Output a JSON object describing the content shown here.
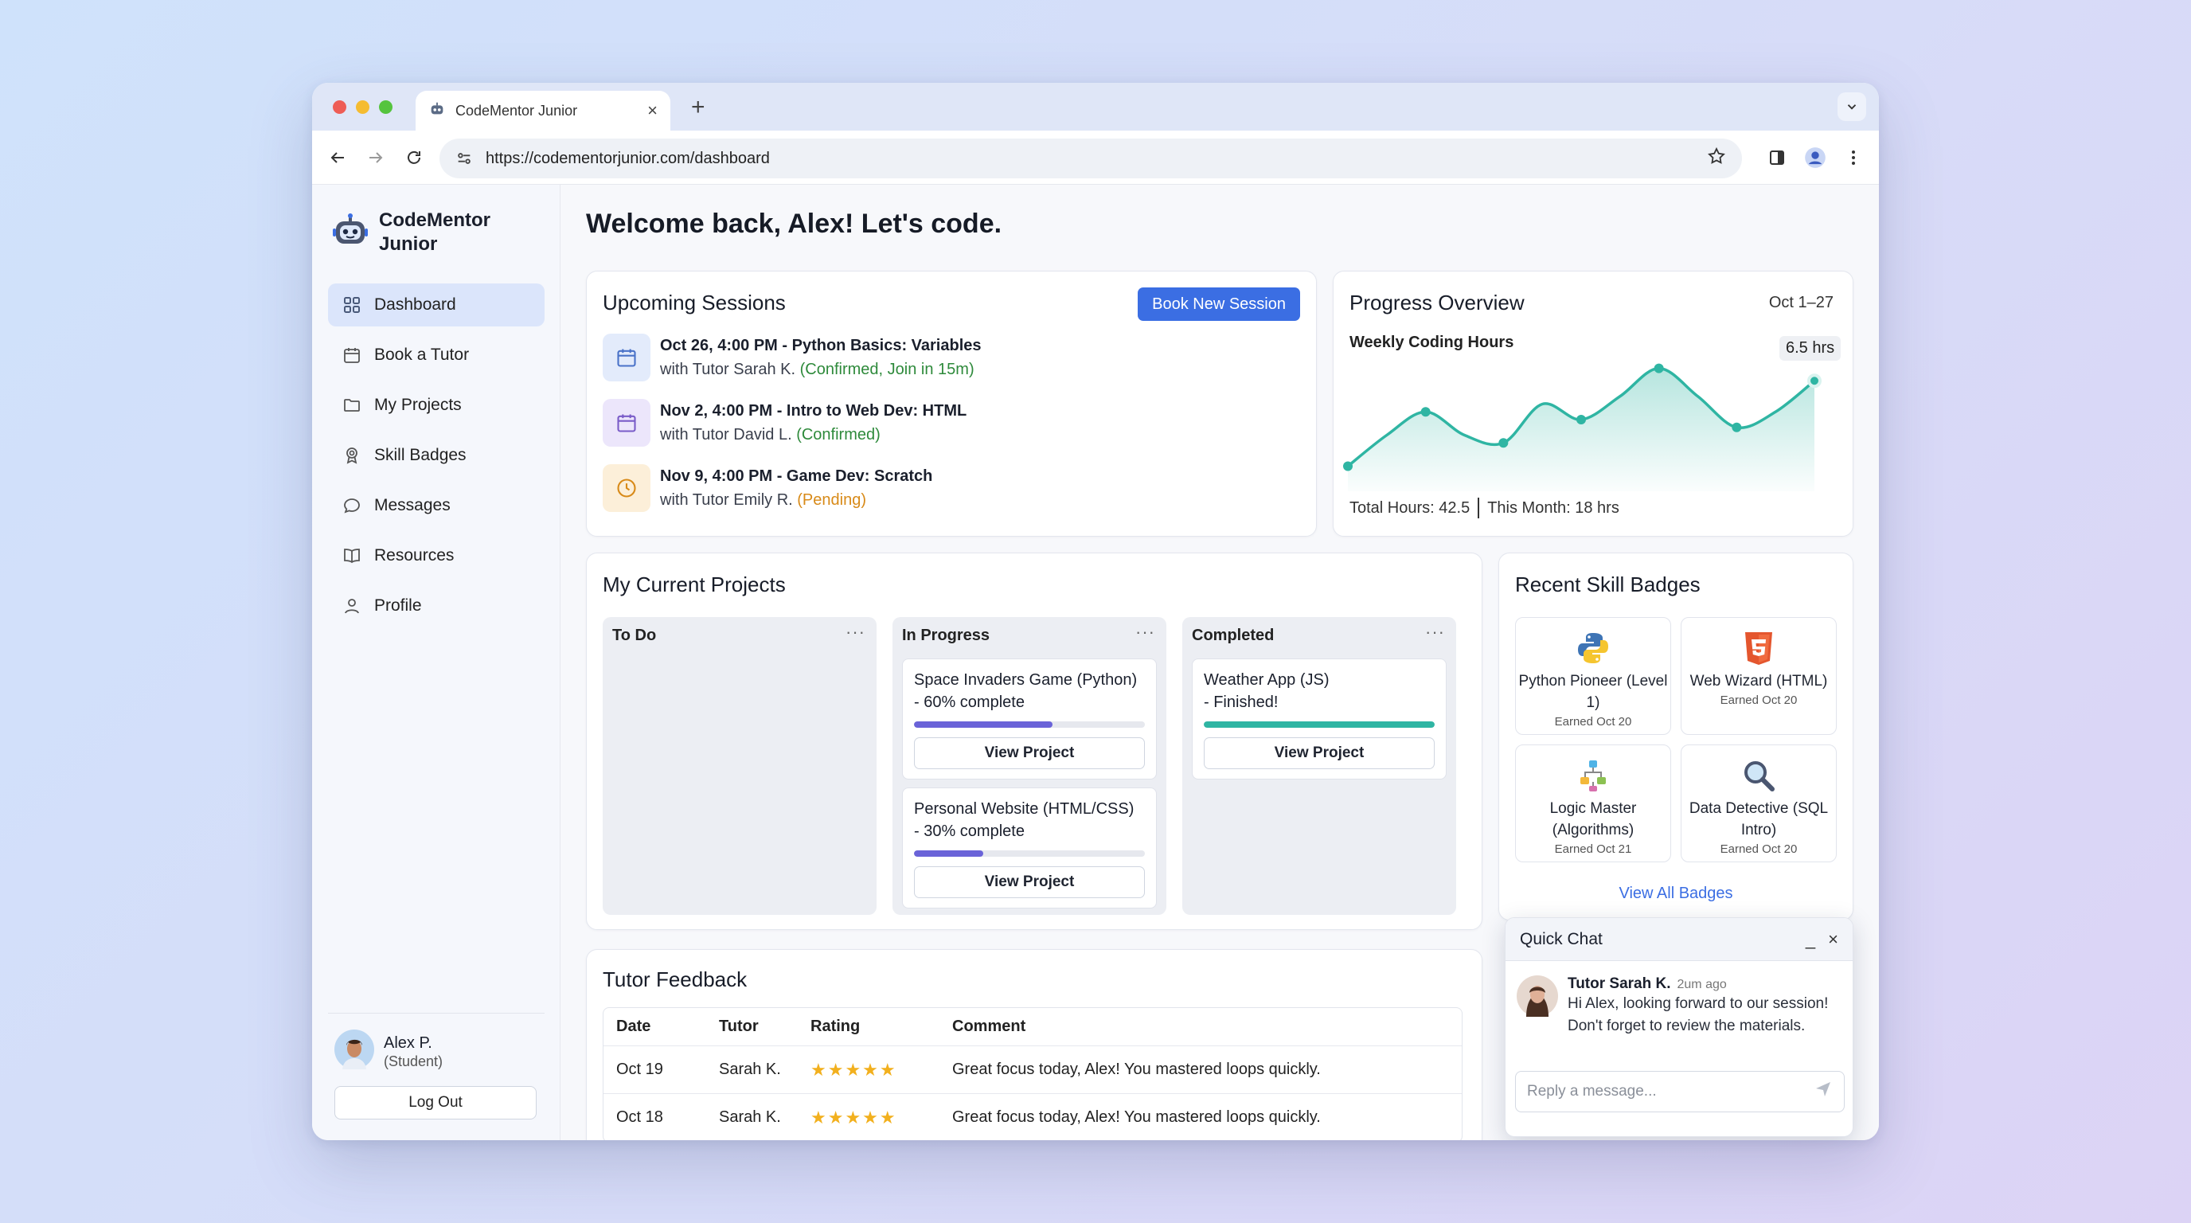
{
  "browser": {
    "tab_title": "CodeMentor Junior",
    "tab_close": "×",
    "new_tab": "+",
    "url": "https://codementorjunior.com/dashboard"
  },
  "sidebar": {
    "brand": "CodeMentor Junior",
    "items": [
      {
        "label": "Dashboard",
        "icon": "grid-icon",
        "active": true
      },
      {
        "label": "Book a Tutor",
        "icon": "calendar-icon"
      },
      {
        "label": "My Projects",
        "icon": "folder-icon"
      },
      {
        "label": "Skill Badges",
        "icon": "badge-icon"
      },
      {
        "label": "Messages",
        "icon": "chat-bubble-icon"
      },
      {
        "label": "Resources",
        "icon": "book-icon"
      },
      {
        "label": "Profile",
        "icon": "person-icon"
      }
    ],
    "user": {
      "name": "Alex P.",
      "role": "(Student)"
    },
    "logout": "Log Out"
  },
  "main": {
    "greeting": "Welcome back, Alex! Let's code."
  },
  "upcoming": {
    "title": "Upcoming Sessions",
    "book_button": "Book New Session",
    "sessions": [
      {
        "title": "Oct 26, 4:00 PM - Python Basics: Variables",
        "tutor": "with Tutor Sarah K.",
        "status": "(Confirmed, Join in 15m)",
        "icon": "calendar-icon",
        "icon_bg": "#e3ebfb",
        "icon_color": "#4a72c8",
        "status_color": "#2e8a3b"
      },
      {
        "title": "Nov 2, 4:00 PM - Intro to Web Dev: HTML",
        "tutor": "with Tutor David L.",
        "status": "(Confirmed)",
        "icon": "calendar-icon",
        "icon_bg": "#ece6fb",
        "icon_color": "#7a5cc8",
        "status_color": "#2e8a3b"
      },
      {
        "title": "Nov 9, 4:00 PM - Game Dev: Scratch",
        "tutor": "with Tutor Emily R.",
        "status": "(Pending)",
        "icon": "clock-icon",
        "icon_bg": "#fcefd9",
        "icon_color": "#d88a18",
        "status_color": "#d88a18"
      }
    ]
  },
  "progress": {
    "title": "Progress Overview",
    "range": "Oct 1–27",
    "subtitle": "Weekly Coding Hours",
    "tooltip": "6.5 hrs",
    "total": "Total Hours: 42.5",
    "month": "This Month: 18 hrs"
  },
  "chart_data": {
    "type": "line",
    "title": "Weekly Coding Hours",
    "x": [
      1,
      2,
      3,
      4,
      5,
      6,
      7,
      8,
      9,
      10,
      11,
      12,
      13
    ],
    "values": [
      1.0,
      3.0,
      4.5,
      3.0,
      2.5,
      5.0,
      4.0,
      5.5,
      7.3,
      5.5,
      3.5,
      4.5,
      6.5
    ],
    "ylim": [
      0,
      8
    ],
    "highlight": {
      "index": 12,
      "label": "6.5 hrs"
    },
    "grid": false,
    "color": "#2fb5a3"
  },
  "projects": {
    "title": "My Current Projects",
    "more": "···",
    "columns": [
      {
        "name": "To Do",
        "cards": []
      },
      {
        "name": "In Progress",
        "cards": [
          {
            "title": "Space Invaders Game (Python)",
            "detail": "- 60% complete",
            "progress": 0.6,
            "color": "#6a63d8",
            "button": "View Project"
          },
          {
            "title": "Personal Website (HTML/CSS)",
            "detail": "- 30% complete",
            "progress": 0.3,
            "color": "#6a63d8",
            "button": "View Project"
          }
        ]
      },
      {
        "name": "Completed",
        "cards": [
          {
            "title": "Weather App (JS)",
            "detail": "- Finished!",
            "progress": 1.0,
            "color": "#2fb5a3",
            "button": "View Project"
          }
        ]
      }
    ]
  },
  "badges": {
    "title": "Recent Skill Badges",
    "items": [
      {
        "name": "Python Pioneer (Level 1)",
        "date": "Earned Oct 20",
        "icon": "python-icon"
      },
      {
        "name": "Web Wizard (HTML)",
        "date": "Earned Oct 20",
        "icon": "html5-icon"
      },
      {
        "name": "Logic Master (Algorithms)",
        "date": "Earned Oct 21",
        "icon": "flowchart-icon"
      },
      {
        "name": "Data Detective (SQL Intro)",
        "date": "Earned Oct 20",
        "icon": "magnifier-icon"
      }
    ],
    "view_all": "View All Badges"
  },
  "feedback": {
    "title": "Tutor Feedback",
    "headers": [
      "Date",
      "Tutor",
      "Rating",
      "Comment"
    ],
    "rows": [
      {
        "date": "Oct 19",
        "tutor": "Sarah K.",
        "rating": "★★★★★",
        "stars": 5,
        "comment": "Great focus today, Alex! You mastered loops quickly."
      },
      {
        "date": "Oct 18",
        "tutor": "Sarah K.",
        "rating": "★★★★★",
        "stars": 5,
        "comment": "Great focus today, Alex! You mastered loops quickly."
      }
    ]
  },
  "chat": {
    "title": "Quick Chat",
    "minimize": "_",
    "close": "×",
    "sender": "Tutor Sarah K.",
    "time": "2um ago",
    "message": "Hi Alex, looking forward to our session! Don't forget to review the materials.",
    "placeholder": "Reply a message..."
  }
}
